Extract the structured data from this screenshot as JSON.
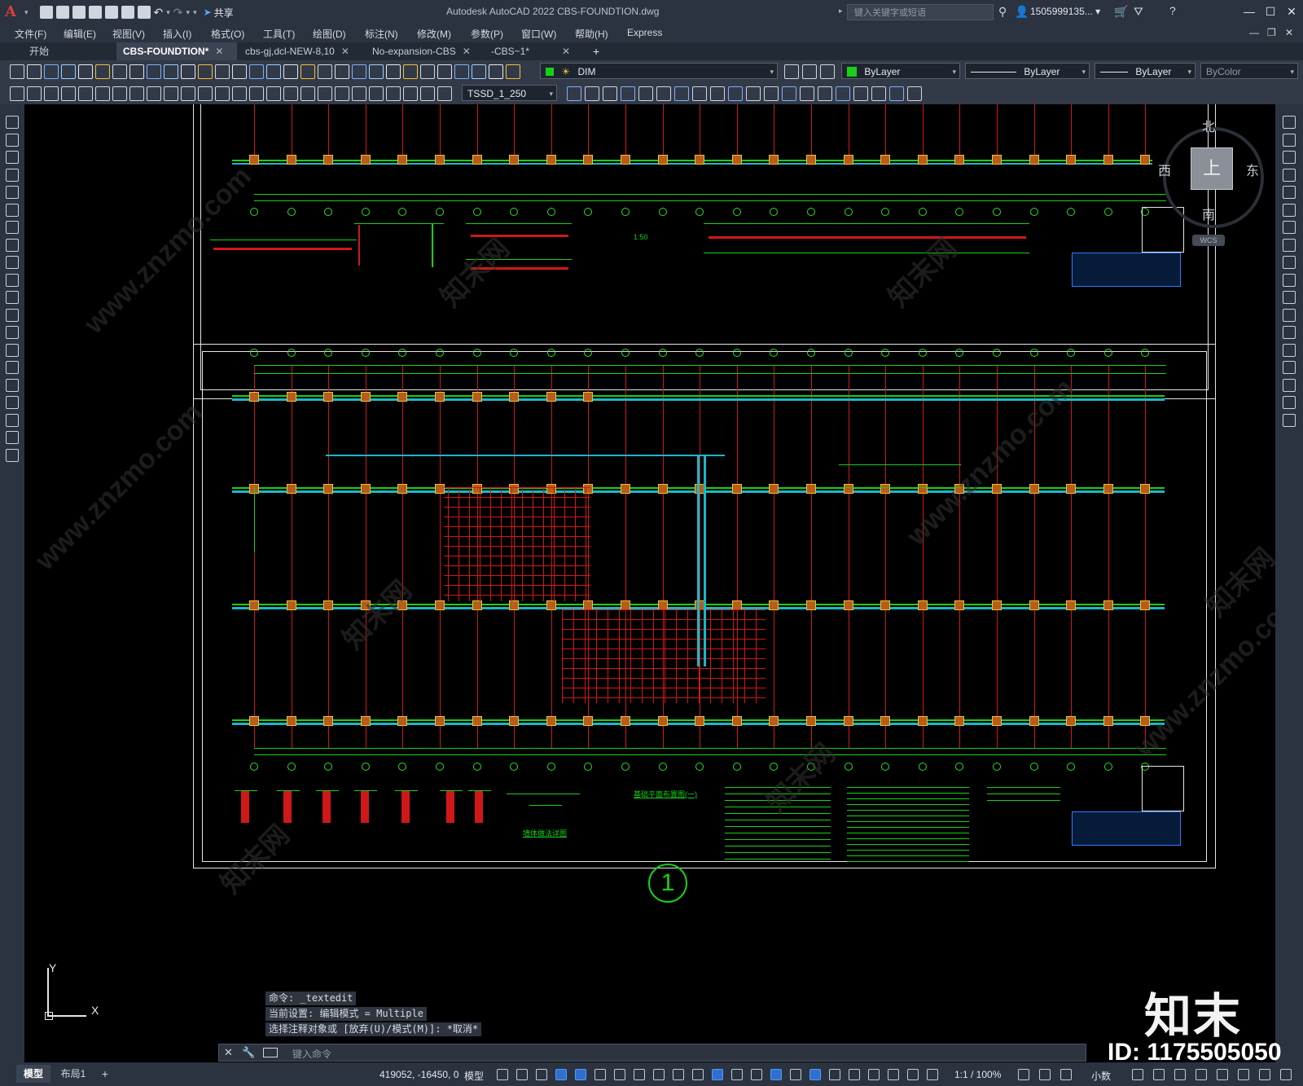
{
  "app": {
    "title": "Autodesk AutoCAD 2022    CBS-FOUNDTION.dwg",
    "share_label": "共享",
    "search_placeholder": "键入关键字或短语",
    "user": "1505999135... ▾"
  },
  "menu": [
    "文件(F)",
    "编辑(E)",
    "视图(V)",
    "插入(I)",
    "格式(O)",
    "工具(T)",
    "绘图(D)",
    "标注(N)",
    "修改(M)",
    "参数(P)",
    "窗口(W)",
    "帮助(H)",
    "Express"
  ],
  "tabs": [
    {
      "label": "开始",
      "active": false
    },
    {
      "label": "CBS-FOUNDTION*",
      "active": true
    },
    {
      "label": "cbs-gj,dcl-NEW-8,10",
      "active": false
    },
    {
      "label": "No-expansion-CBS",
      "active": false
    },
    {
      "label": "-CBS~1*",
      "active": false
    }
  ],
  "toolbar": {
    "layer": "DIM",
    "color": "ByLayer",
    "linetype": "ByLayer",
    "lineweight": "ByLayer",
    "plotstyle": "ByColor",
    "textstyle": "TSSD_1_250"
  },
  "viewcube": {
    "north": "北",
    "south": "南",
    "east": "东",
    "west": "西",
    "top": "上",
    "wcs": "WCS"
  },
  "drawing": {
    "upper_view_label": "1:50",
    "lower_plan_title": "基础平面布置图(一)",
    "detail_label": "墙体做法详图",
    "sheet_number": "1"
  },
  "ucs": {
    "x": "X",
    "y": "Y"
  },
  "command_history": [
    "命令: _textedit",
    "当前设置: 编辑模式 = Multiple",
    "选择注释对象或 [放弃(U)/模式(M)]: *取消*"
  ],
  "command_placeholder": "键入命令",
  "status": {
    "model_tab": "模型",
    "layout_tab": "布局1",
    "coords": "419052, -16450, 0",
    "model_space": "模型",
    "scale": "1:1 / 100%",
    "units": "小数"
  },
  "watermark": {
    "brand": "知末",
    "id": "ID: 1175505050",
    "site": "www.znzmo.com",
    "site_cn": "知末网"
  },
  "colors": {
    "green": "#18d018",
    "red": "#d01818",
    "cyan": "#19b8c8",
    "accent": "#2f6fd0"
  }
}
